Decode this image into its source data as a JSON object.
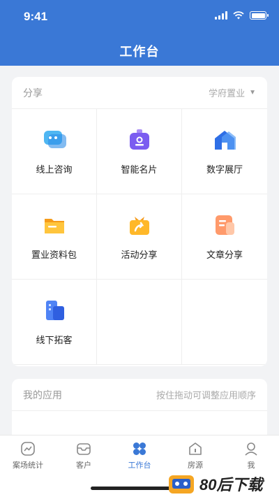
{
  "status": {
    "time": "9:41"
  },
  "header": {
    "title": "工作台"
  },
  "share": {
    "title": "分享",
    "selector": "学府置业",
    "items": [
      {
        "label": "线上咨询",
        "icon": "chat-bubble-icon"
      },
      {
        "label": "智能名片",
        "icon": "business-card-icon"
      },
      {
        "label": "数字展厅",
        "icon": "house-icon"
      },
      {
        "label": "置业资料包",
        "icon": "folder-icon"
      },
      {
        "label": "活动分享",
        "icon": "gift-share-icon"
      },
      {
        "label": "文章分享",
        "icon": "article-icon"
      },
      {
        "label": "线下拓客",
        "icon": "building-icon"
      }
    ]
  },
  "apps": {
    "title": "我的应用",
    "hint": "按住拖动可调整应用顺序"
  },
  "nav": {
    "items": [
      {
        "label": "案场统计",
        "icon": "chart-icon"
      },
      {
        "label": "客户",
        "icon": "inbox-icon"
      },
      {
        "label": "工作台",
        "icon": "workbench-icon"
      },
      {
        "label": "房源",
        "icon": "house-outline-icon"
      },
      {
        "label": "我",
        "icon": "user-icon"
      }
    ],
    "active": "工作台"
  },
  "watermark": {
    "text": "80后下载"
  },
  "colors": {
    "primary": "#3a78d6",
    "background": "#f2f3f5"
  }
}
